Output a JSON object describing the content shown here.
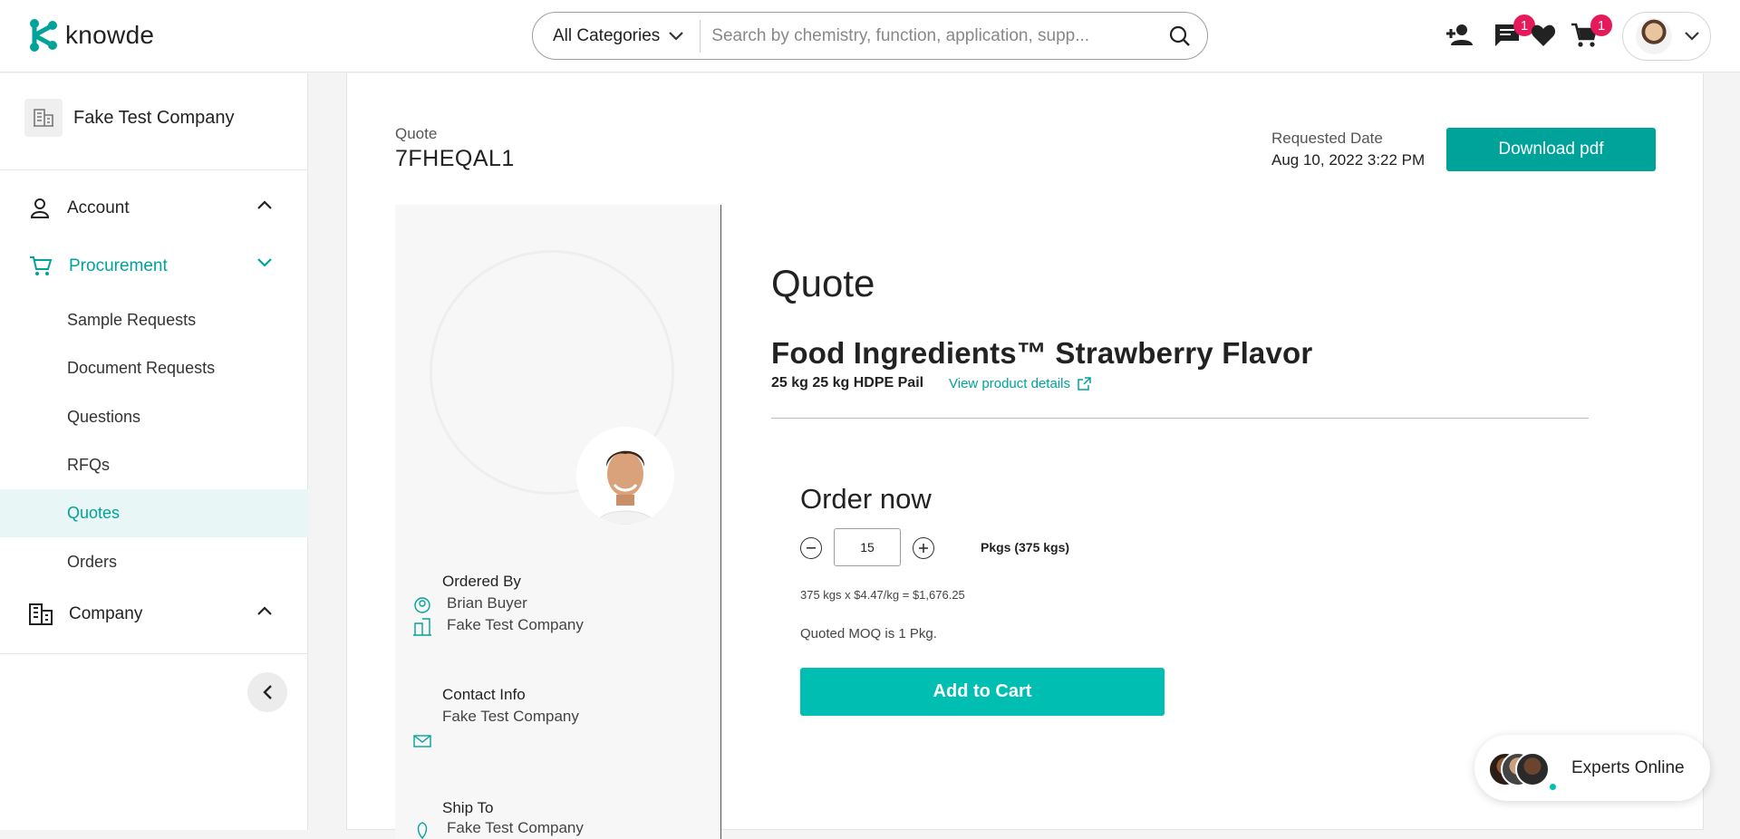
{
  "header": {
    "logo_text": "knowde",
    "category_label": "All Categories",
    "search_placeholder": "Search by chemistry, function, application, supp...",
    "messages_badge": "1",
    "cart_badge": "1"
  },
  "sidebar": {
    "company_name": "Fake Test Company",
    "groups": {
      "account": "Account",
      "procurement": "Procurement",
      "company": "Company"
    },
    "items": [
      "Sample Requests",
      "Document Requests",
      "Questions",
      "RFQs",
      "Quotes",
      "Orders"
    ],
    "active_item": "Quotes"
  },
  "quote": {
    "label": "Quote",
    "id": "7FHEQAL1",
    "requested_label": "Requested Date",
    "requested_date": "Aug 10, 2022 3:22 PM",
    "download_label": "Download pdf",
    "title": "Quote",
    "product_name": "Food Ingredients™ Strawberry Flavor",
    "package": "25 kg 25 kg HDPE Pail",
    "view_link": "View product details"
  },
  "details": {
    "ordered_by_label": "Ordered By",
    "ordered_by_name": "Brian Buyer",
    "ordered_by_company": "Fake Test Company",
    "contact_label": "Contact Info",
    "contact_company": "Fake Test Company",
    "ship_label": "Ship To",
    "ship_company": "Fake Test Company"
  },
  "order": {
    "title": "Order now",
    "quantity": "15",
    "unit_label": "Pkgs (375 kgs)",
    "calculation": "375 kgs x $4.47/kg = $1,676.25",
    "moq": "Quoted MOQ is 1 Pkg.",
    "add_to_cart": "Add to Cart"
  },
  "experts": {
    "label": "Experts Online"
  },
  "colors": {
    "accent": "#00a39a",
    "button": "#00bfb2",
    "badge": "#e6195a"
  }
}
